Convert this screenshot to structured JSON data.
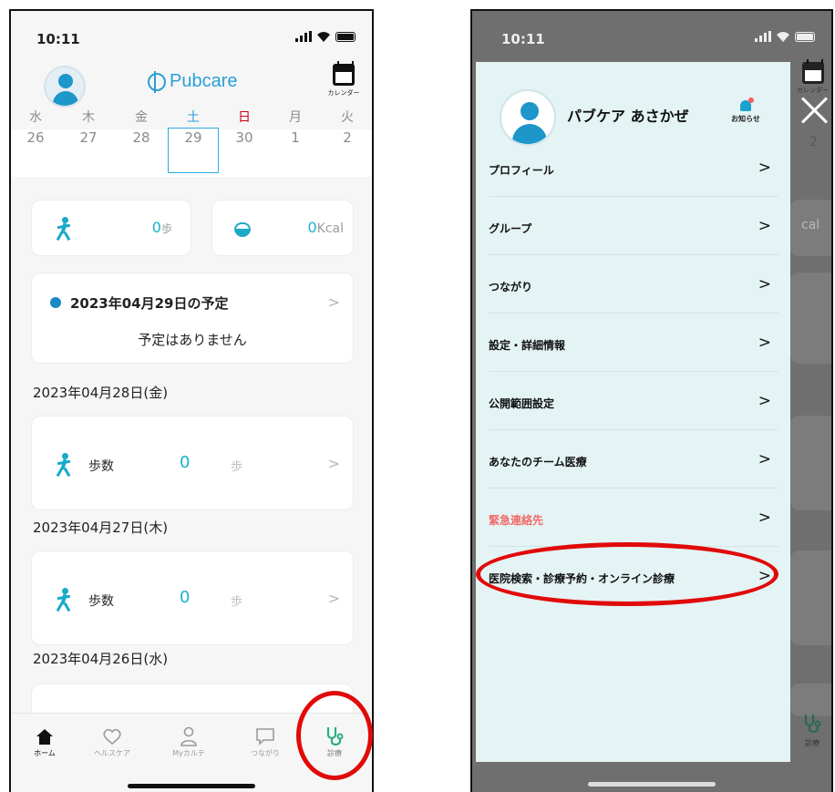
{
  "status": {
    "time": "10:11"
  },
  "left": {
    "app_logo": "Pubcare",
    "calendar_label": "カレンダー",
    "week": [
      {
        "wd": "水",
        "dn": "26"
      },
      {
        "wd": "木",
        "dn": "27"
      },
      {
        "wd": "金",
        "dn": "28"
      },
      {
        "wd": "土",
        "dn": "29"
      },
      {
        "wd": "日",
        "dn": "30"
      },
      {
        "wd": "月",
        "dn": "1"
      },
      {
        "wd": "火",
        "dn": "2"
      }
    ],
    "steps_today": {
      "value": "0",
      "unit": "歩"
    },
    "kcal_today": {
      "value": "0",
      "unit": "Kcal"
    },
    "schedule": {
      "title": "2023年04月29日の予定",
      "empty": "予定はありません",
      "chevron": ">"
    },
    "days": [
      {
        "date": "2023年04月28日(金)",
        "label": "歩数",
        "value": "0",
        "unit": "歩",
        "chevron": ">"
      },
      {
        "date": "2023年04月27日(木)",
        "label": "歩数",
        "value": "0",
        "unit": "歩",
        "chevron": ">"
      },
      {
        "date": "2023年04月26日(水)"
      }
    ],
    "tabs": [
      "ホーム",
      "ヘルスケア",
      "Myカルテ",
      "つながり",
      "診療"
    ]
  },
  "right": {
    "user_name": "パブケア あさかぜ",
    "notice_label": "お知らせ",
    "menu": [
      {
        "label": "プロフィール",
        "chev": ">"
      },
      {
        "label": "グループ",
        "chev": ">"
      },
      {
        "label": "つながり",
        "chev": ">"
      },
      {
        "label": "設定・詳細情報",
        "chev": ">"
      },
      {
        "label": "公開範囲設定",
        "chev": ">"
      },
      {
        "label": "あなたのチーム医療",
        "chev": ">"
      },
      {
        "label": "緊急連絡先",
        "chev": ">"
      },
      {
        "label": "医院検索・診療予約・オンライン診療",
        "chev": ">"
      }
    ],
    "peek": {
      "calendar_label": "カレンダー",
      "date": "2",
      "kcal": "cal",
      "tab": "診療"
    }
  },
  "colors": {
    "accent": "#17b3d0",
    "highlight": "#e10a0a",
    "drawer": "#e4f3f4",
    "danger": "#f26a6a"
  }
}
